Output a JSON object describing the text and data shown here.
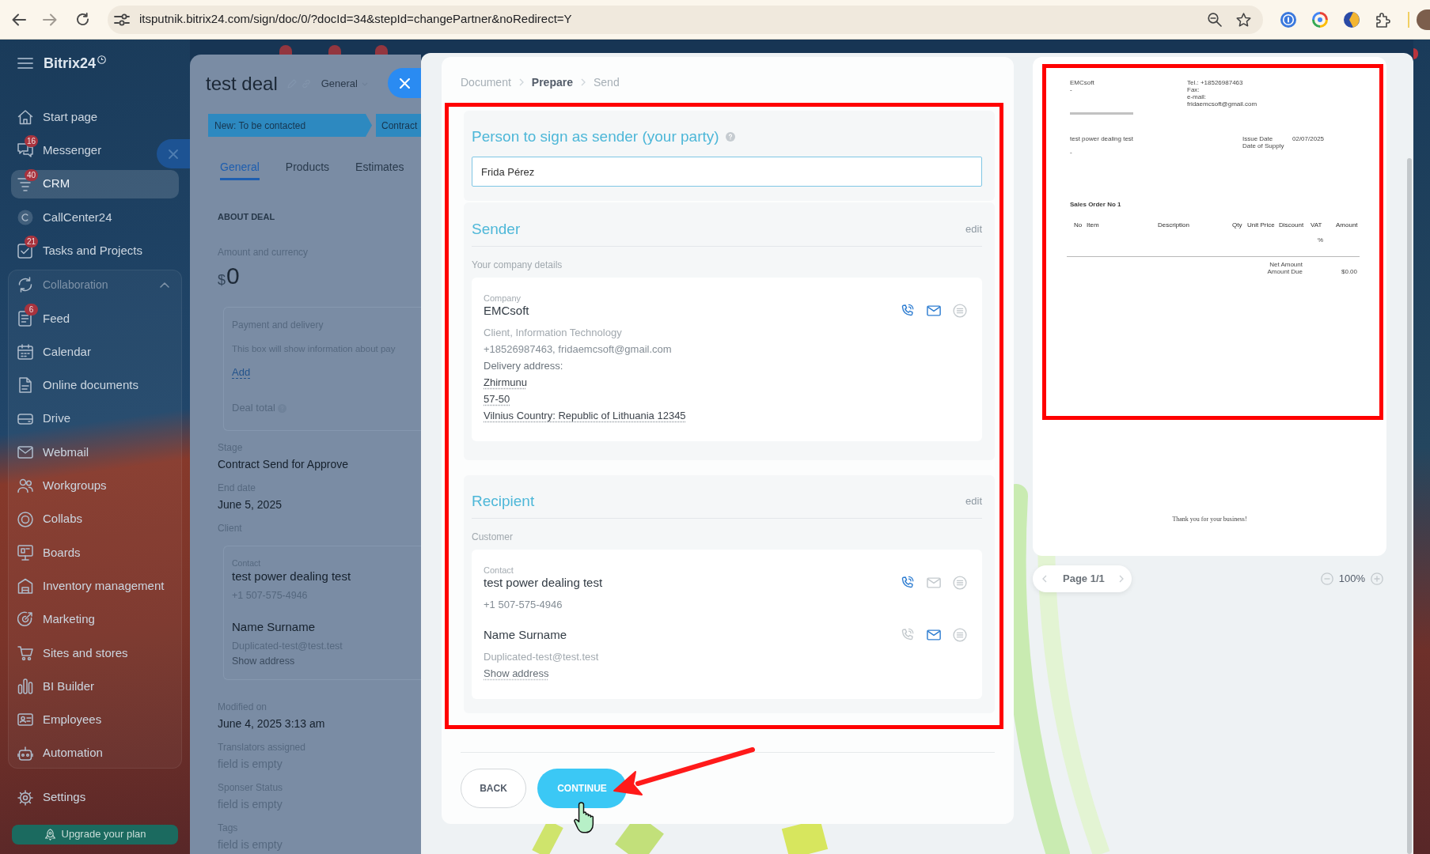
{
  "browser": {
    "url": "itsputnik.bitrix24.com/sign/doc/0/?docId=34&stepId=changePartner&noRedirect=Y"
  },
  "sidebar": {
    "logo": "Bitrix24",
    "items": [
      {
        "label": "Start page",
        "selected": false
      },
      {
        "label": "Messenger",
        "badge": "16",
        "selected": false
      },
      {
        "label": "CRM",
        "badge": "40",
        "selected": true
      },
      {
        "label": "CallCenter24",
        "selected": false
      },
      {
        "label": "Tasks and Projects",
        "badge": "21",
        "selected": false
      },
      {
        "label": "Collaboration",
        "selected": false,
        "expanded": true,
        "children": [
          {
            "label": "Feed",
            "badge": "6",
            "selected": false
          },
          {
            "label": "Calendar",
            "selected": false
          },
          {
            "label": "Online documents",
            "selected": false
          },
          {
            "label": "Drive",
            "selected": false
          },
          {
            "label": "Webmail",
            "selected": false
          },
          {
            "label": "Workgroups",
            "selected": false
          },
          {
            "label": "Collabs",
            "selected": false
          },
          {
            "label": "Boards",
            "selected": false
          },
          {
            "label": "Inventory management",
            "selected": false
          },
          {
            "label": "Marketing",
            "selected": false
          },
          {
            "label": "Sites and stores",
            "selected": false
          },
          {
            "label": "BI Builder",
            "selected": false
          },
          {
            "label": "Employees",
            "selected": false
          },
          {
            "label": "Automation",
            "selected": false
          }
        ]
      }
    ],
    "settings": "Settings",
    "upgrade": "Upgrade your plan"
  },
  "deal": {
    "title": "test deal",
    "category": "General",
    "stages": [
      "New: To be contacted",
      "Contract"
    ],
    "tabs": [
      {
        "label": "General",
        "selected": true
      },
      {
        "label": "Products",
        "selected": false
      },
      {
        "label": "Estimates",
        "selected": false
      }
    ],
    "section": "ABOUT DEAL",
    "amount": {
      "label": "Amount and currency",
      "currency": "$",
      "value": "0"
    },
    "payment": {
      "title": "Payment and delivery",
      "text": "This box will show information about pay",
      "link": "Add",
      "total": "Deal total"
    },
    "fields": [
      {
        "label": "Stage",
        "value": "Contract Send for Approve",
        "empty": false
      },
      {
        "label": "End date",
        "value": "June 5, 2025",
        "empty": false
      }
    ],
    "client": {
      "label": "Client",
      "contacts": [
        {
          "type": "Contact",
          "name": "test power dealing test",
          "details": [
            "+1 507-575-4946"
          ]
        },
        {
          "name": "Name Surname",
          "details": [
            "Duplicated-test@test.test"
          ],
          "link": "Show address"
        }
      ]
    },
    "more_fields": [
      {
        "label": "Modified on",
        "value": "June 4, 2025 3:13 am",
        "empty": false
      },
      {
        "label": "Translators assigned",
        "value": "field is empty",
        "empty": true
      },
      {
        "label": "Sponser Status",
        "value": "field is empty",
        "empty": true
      },
      {
        "label": "Tags",
        "value": "field is empty",
        "empty": true
      }
    ]
  },
  "sign": {
    "steps": [
      {
        "label": "Document",
        "selected": false
      },
      {
        "label": "Prepare",
        "selected": true
      },
      {
        "label": "Send",
        "selected": false
      }
    ],
    "signer": {
      "title": "Person to sign as sender (your party)",
      "value": "Frida Pérez"
    },
    "parties": [
      {
        "title": "Sender",
        "action": "edit",
        "subtitle": "Your company details",
        "entities": [
          {
            "type": "Company",
            "name": "EMCsoft",
            "phone": true,
            "email": true,
            "chat": false,
            "lines": [
              {
                "text": "Client, Information Technology",
                "kind": "muted"
              },
              {
                "text": "+18526987463, fridaemcsoft@gmail.com",
                "kind": "contact"
              },
              {
                "text": "Delivery address:",
                "kind": "label"
              },
              {
                "text": "Zhirmunu",
                "kind": "address"
              },
              {
                "text": "57-50",
                "kind": "address"
              },
              {
                "text": "Vilnius Country: Republic of Lithuania 12345",
                "kind": "address"
              }
            ]
          }
        ]
      },
      {
        "title": "Recipient",
        "action": "edit",
        "subtitle": "Customer",
        "entities": [
          {
            "type": "Contact",
            "name": "test power dealing test",
            "phone": true,
            "email": false,
            "chat": false,
            "lines": [
              {
                "text": "+1 507-575-4946",
                "kind": "contact"
              }
            ]
          },
          {
            "name": "Name Surname",
            "phone": false,
            "email": true,
            "chat": false,
            "lines": [
              {
                "text": "Duplicated-test@test.test",
                "kind": "muted"
              },
              {
                "text": "Show address",
                "kind": "link"
              }
            ]
          }
        ]
      }
    ],
    "buttons": [
      {
        "label": "BACK",
        "kind": "secondary"
      },
      {
        "label": "CONTINUE",
        "kind": "primary"
      }
    ]
  },
  "preview": {
    "document": {
      "seller": [
        "EMCsoft",
        "-"
      ],
      "seller_contacts": [
        "Tel.: +18526987463",
        "Fax:",
        "e-mail:",
        "fridaemcsoft@gmail.com"
      ],
      "buyer": [
        "test power dealing test",
        "-"
      ],
      "dates": [
        {
          "label": "Issue Date",
          "value": "02/07/2025"
        },
        {
          "label": "Date of Supply"
        }
      ],
      "title": "Sales Order No 1",
      "columns": [
        "No",
        "Item",
        "Description",
        "Qty",
        "Unit Price",
        "Discount",
        "VAT",
        "Amount"
      ],
      "vat_mark": "%",
      "totals": [
        {
          "label": "Net Amount"
        },
        {
          "label": "Amount Due",
          "value": "$0.00"
        }
      ],
      "footer": "Thank you for your business!"
    },
    "pager": "Page 1/1",
    "zoom": "100%"
  }
}
